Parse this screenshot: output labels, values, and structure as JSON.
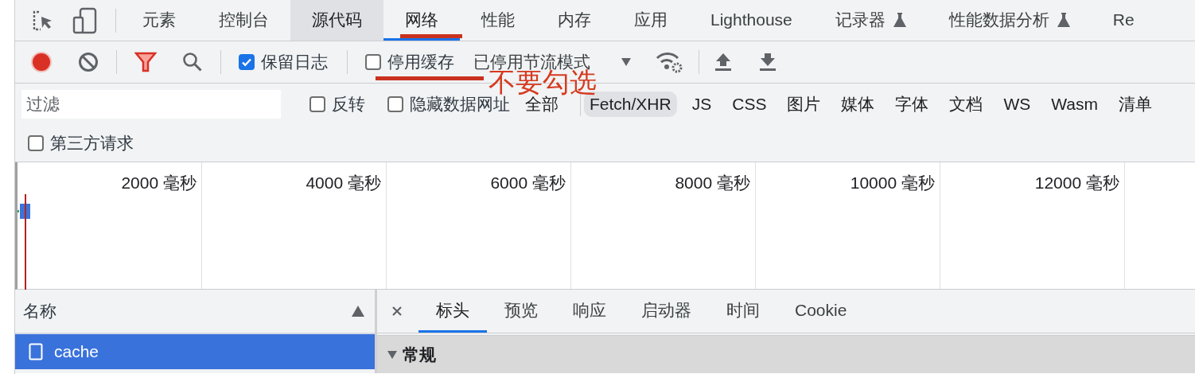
{
  "tabs": [
    {
      "label": "元素",
      "selected": false,
      "hovered": false,
      "kind": "plain"
    },
    {
      "label": "控制台",
      "selected": false,
      "hovered": false,
      "kind": "plain"
    },
    {
      "label": "源代码",
      "selected": false,
      "hovered": true,
      "kind": "plain"
    },
    {
      "label": "网络",
      "selected": true,
      "hovered": false,
      "kind": "plain"
    },
    {
      "label": "性能",
      "selected": false,
      "hovered": false,
      "kind": "plain"
    },
    {
      "label": "内存",
      "selected": false,
      "hovered": false,
      "kind": "plain"
    },
    {
      "label": "应用",
      "selected": false,
      "hovered": false,
      "kind": "plain"
    },
    {
      "label": "Lighthouse",
      "selected": false,
      "hovered": false,
      "kind": "plain"
    },
    {
      "label": "记录器",
      "selected": false,
      "hovered": false,
      "kind": "experimental"
    },
    {
      "label": "性能数据分析",
      "selected": false,
      "hovered": false,
      "kind": "experimental"
    },
    {
      "label": "Re",
      "selected": false,
      "hovered": false,
      "kind": "plain"
    }
  ],
  "toolbar": {
    "recording": true,
    "preserve_log": {
      "label": "保留日志",
      "checked": true
    },
    "disable_cache": {
      "label": "停用缓存",
      "checked": false
    },
    "throttling": "已停用节流模式"
  },
  "annotation": {
    "text": "不要勾选"
  },
  "filter": {
    "placeholder": "过滤",
    "options": [
      {
        "label": "反转",
        "checked": false
      },
      {
        "label": "隐藏数据网址",
        "checked": false
      }
    ],
    "types": [
      {
        "label": "全部",
        "selected": false
      },
      {
        "label": "Fetch/XHR",
        "selected": true
      },
      {
        "label": "JS",
        "selected": false
      },
      {
        "label": "CSS",
        "selected": false
      },
      {
        "label": "图片",
        "selected": false
      },
      {
        "label": "媒体",
        "selected": false
      },
      {
        "label": "字体",
        "selected": false
      },
      {
        "label": "文档",
        "selected": false
      },
      {
        "label": "WS",
        "selected": false
      },
      {
        "label": "Wasm",
        "selected": false
      },
      {
        "label": "清单",
        "selected": false
      }
    ],
    "third_party": {
      "label": "第三方请求",
      "checked": false
    }
  },
  "timeline": {
    "labels": [
      "2000 毫秒",
      "4000 毫秒",
      "6000 毫秒",
      "8000 毫秒",
      "10000 毫秒",
      "12000 毫秒"
    ]
  },
  "requests": {
    "column": "名称",
    "rows": [
      {
        "name": "cache",
        "selected": true
      }
    ]
  },
  "details": {
    "tabs": [
      {
        "label": "标头",
        "selected": true
      },
      {
        "label": "预览",
        "selected": false
      },
      {
        "label": "响应",
        "selected": false
      },
      {
        "label": "启动器",
        "selected": false
      },
      {
        "label": "时间",
        "selected": false
      },
      {
        "label": "Cookie",
        "selected": false
      }
    ],
    "section": {
      "title": "常规",
      "expanded": true
    }
  }
}
